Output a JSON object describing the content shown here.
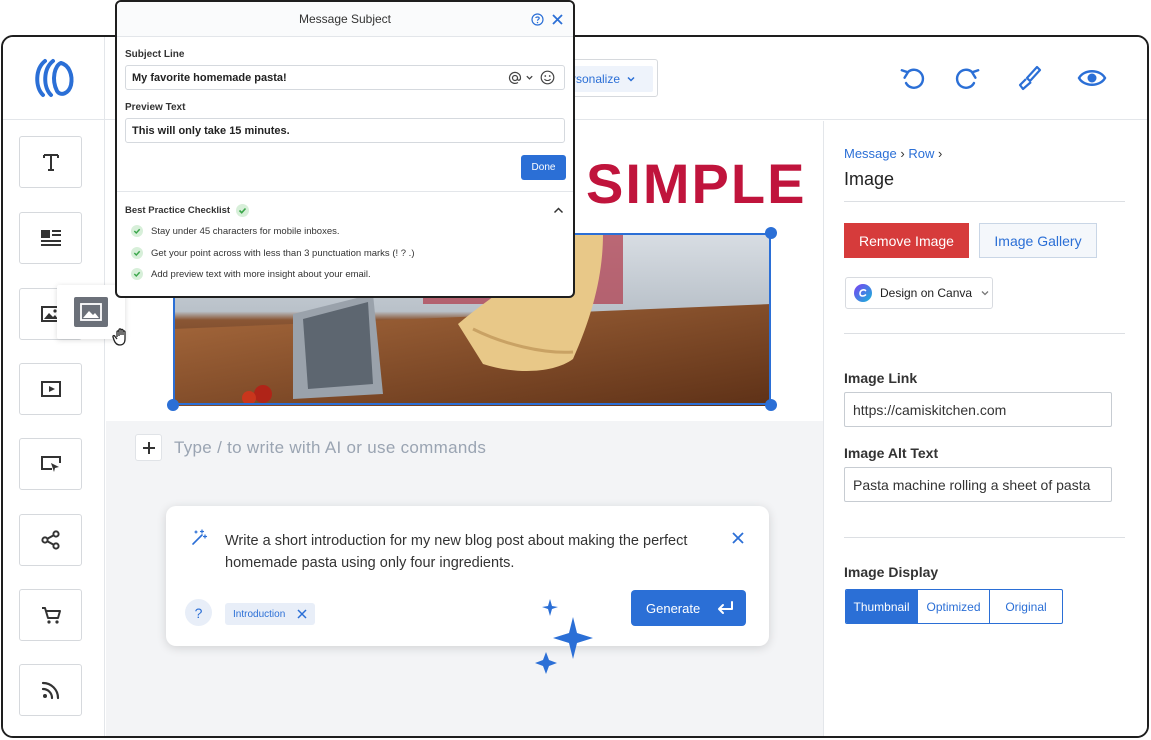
{
  "popup": {
    "title": "Message Subject",
    "subject_label": "Subject Line",
    "subject_value": "My favorite homemade pasta!",
    "preview_label": "Preview Text",
    "preview_value": "This will only take 15 minutes.",
    "done_label": "Done",
    "checklist_title": "Best Practice Checklist",
    "checklist": [
      "Stay under 45 characters for mobile inboxes.",
      "Get your point across with less than 3 punctuation marks (! ? .)",
      "Add preview text with more insight about your email."
    ]
  },
  "toolbar": {
    "personalize_label": "rsonalize"
  },
  "canvas": {
    "headline": "SIMPLE",
    "command_placeholder": "Type / to write with AI or use commands"
  },
  "ai_prompt": {
    "text_line1": "Write a short introduction for my new blog post about making the perfect",
    "text_line2": "homemade pasta using only four ingredients.",
    "tag": "Introduction",
    "generate_label": "Generate"
  },
  "panel": {
    "breadcrumb_message": "Message",
    "breadcrumb_row": "Row",
    "title": "Image",
    "remove_image": "Remove Image",
    "image_gallery": "Image Gallery",
    "design_canva": "Design on Canva",
    "image_link_label": "Image Link",
    "image_link_value": "https://camiskitchen.com",
    "alt_text_label": "Image Alt Text",
    "alt_text_value": "Pasta machine rolling a sheet of pasta",
    "display_label": "Image Display",
    "display_options": [
      "Thumbnail",
      "Optimized",
      "Original"
    ],
    "display_selected": "Thumbnail"
  },
  "colors": {
    "accent": "#2b6fd6",
    "headline": "#c0143c",
    "danger": "#d63b3b",
    "success": "#3aa64a"
  }
}
